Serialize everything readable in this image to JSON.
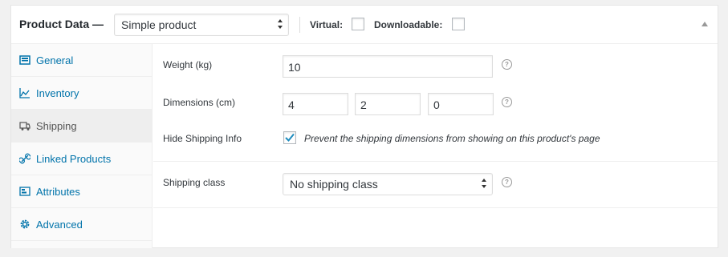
{
  "header": {
    "title": "Product Data —",
    "product_type": "Simple product",
    "virtual_label": "Virtual:",
    "downloadable_label": "Downloadable:"
  },
  "tabs": [
    {
      "label": "General",
      "icon": "general-icon"
    },
    {
      "label": "Inventory",
      "icon": "inventory-icon"
    },
    {
      "label": "Shipping",
      "icon": "shipping-icon"
    },
    {
      "label": "Linked Products",
      "icon": "link-icon"
    },
    {
      "label": "Attributes",
      "icon": "attributes-icon"
    },
    {
      "label": "Advanced",
      "icon": "gear-icon"
    }
  ],
  "shipping": {
    "weight_label": "Weight (kg)",
    "weight_value": "10",
    "dimensions_label": "Dimensions (cm)",
    "length": "4",
    "width": "2",
    "height": "0",
    "hide_label": "Hide Shipping Info",
    "hide_checked": true,
    "hide_description": "Prevent the shipping dimensions from showing on this product's page",
    "class_label": "Shipping class",
    "class_value": "No shipping class"
  },
  "help_glyph": "?",
  "colors": {
    "link": "#0073aa",
    "active_tab_bg": "#eeeeee"
  }
}
